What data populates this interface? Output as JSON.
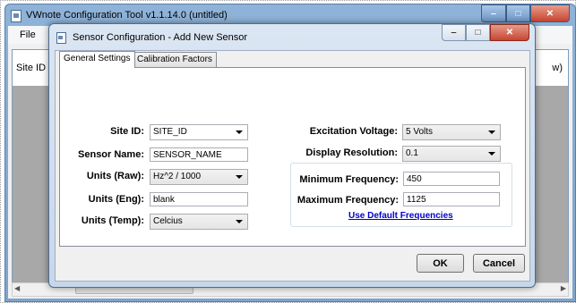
{
  "main_window": {
    "title": "VWnote Configuration Tool v1.1.14.0 (untitled)",
    "menu": [
      "File"
    ],
    "table": {
      "col_site": "Site ID",
      "col_right": "w)"
    }
  },
  "dialog": {
    "title": "Sensor Configuration - Add New Sensor",
    "tabs": [
      "General Settings",
      "Calibration Factors"
    ],
    "labels": {
      "site_id": "Site ID:",
      "sensor_name": "Sensor Name:",
      "units_raw": "Units (Raw):",
      "units_eng": "Units (Eng):",
      "units_temp": "Units (Temp):",
      "excitation_voltage": "Excitation Voltage:",
      "display_resolution": "Display Resolution:",
      "min_frequency": "Minimum Frequency:",
      "max_frequency": "Maximum Frequency:"
    },
    "values": {
      "site_id": "SITE_ID",
      "sensor_name": "SENSOR_NAME",
      "units_raw": "Hz^2 / 1000",
      "units_eng": "blank",
      "units_temp": "Celcius",
      "excitation_voltage": "5 Volts",
      "display_resolution": "0.1",
      "min_frequency": "450",
      "max_frequency": "1125"
    },
    "default_link": "Use Default Frequencies",
    "ok": "OK",
    "cancel": "Cancel"
  },
  "caption_glyphs": {
    "minimize": "‒",
    "maximize": "□",
    "close": "✕"
  }
}
